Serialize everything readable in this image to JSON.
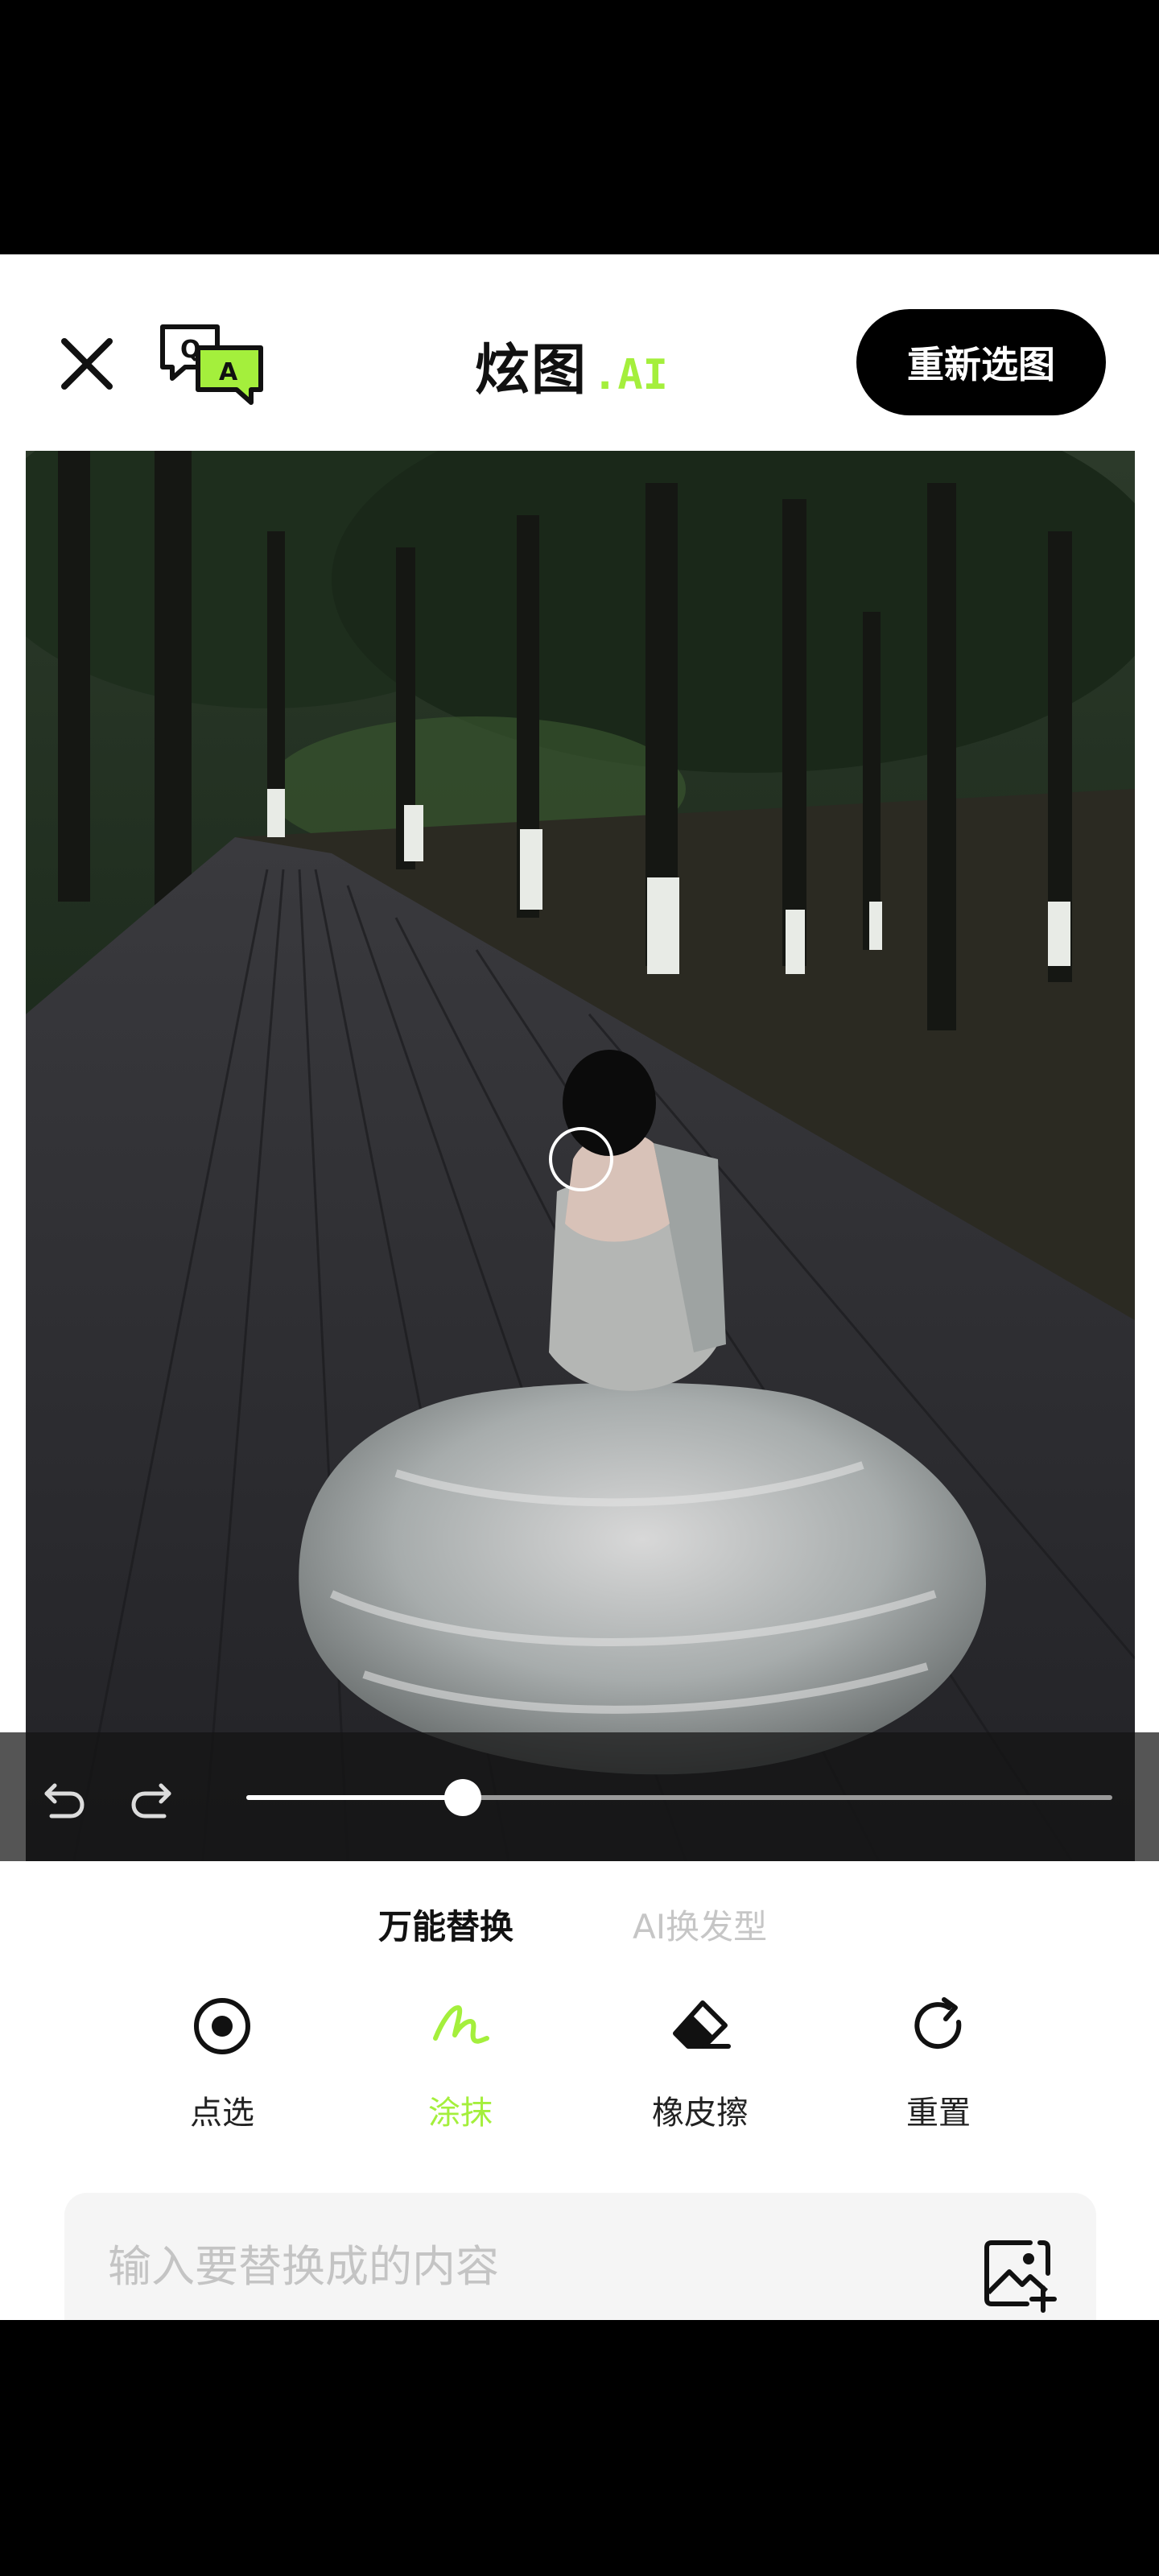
{
  "header": {
    "brand_cn": "炫图",
    "brand_ai": ".AI",
    "reselect_label": "重新选图",
    "close_icon": "close-icon",
    "qa_icon": "qa-chat-icon"
  },
  "editor": {
    "undo_icon": "undo-icon",
    "redo_icon": "redo-icon",
    "brush_size_fraction": 0.25
  },
  "tabs": [
    {
      "label": "万能替换",
      "active": true
    },
    {
      "label": "AI换发型",
      "active": false
    }
  ],
  "tools": [
    {
      "label": "点选",
      "icon": "target-icon",
      "active": false
    },
    {
      "label": "涂抹",
      "icon": "brush-icon",
      "active": true
    },
    {
      "label": "橡皮擦",
      "icon": "eraser-icon",
      "active": false
    },
    {
      "label": "重置",
      "icon": "reset-icon",
      "active": false
    }
  ],
  "prompt": {
    "placeholder": "输入要替换成的内容",
    "image_icon": "image-add-icon"
  },
  "colors": {
    "accent": "#a4ef3c",
    "button_bg": "#000000"
  }
}
